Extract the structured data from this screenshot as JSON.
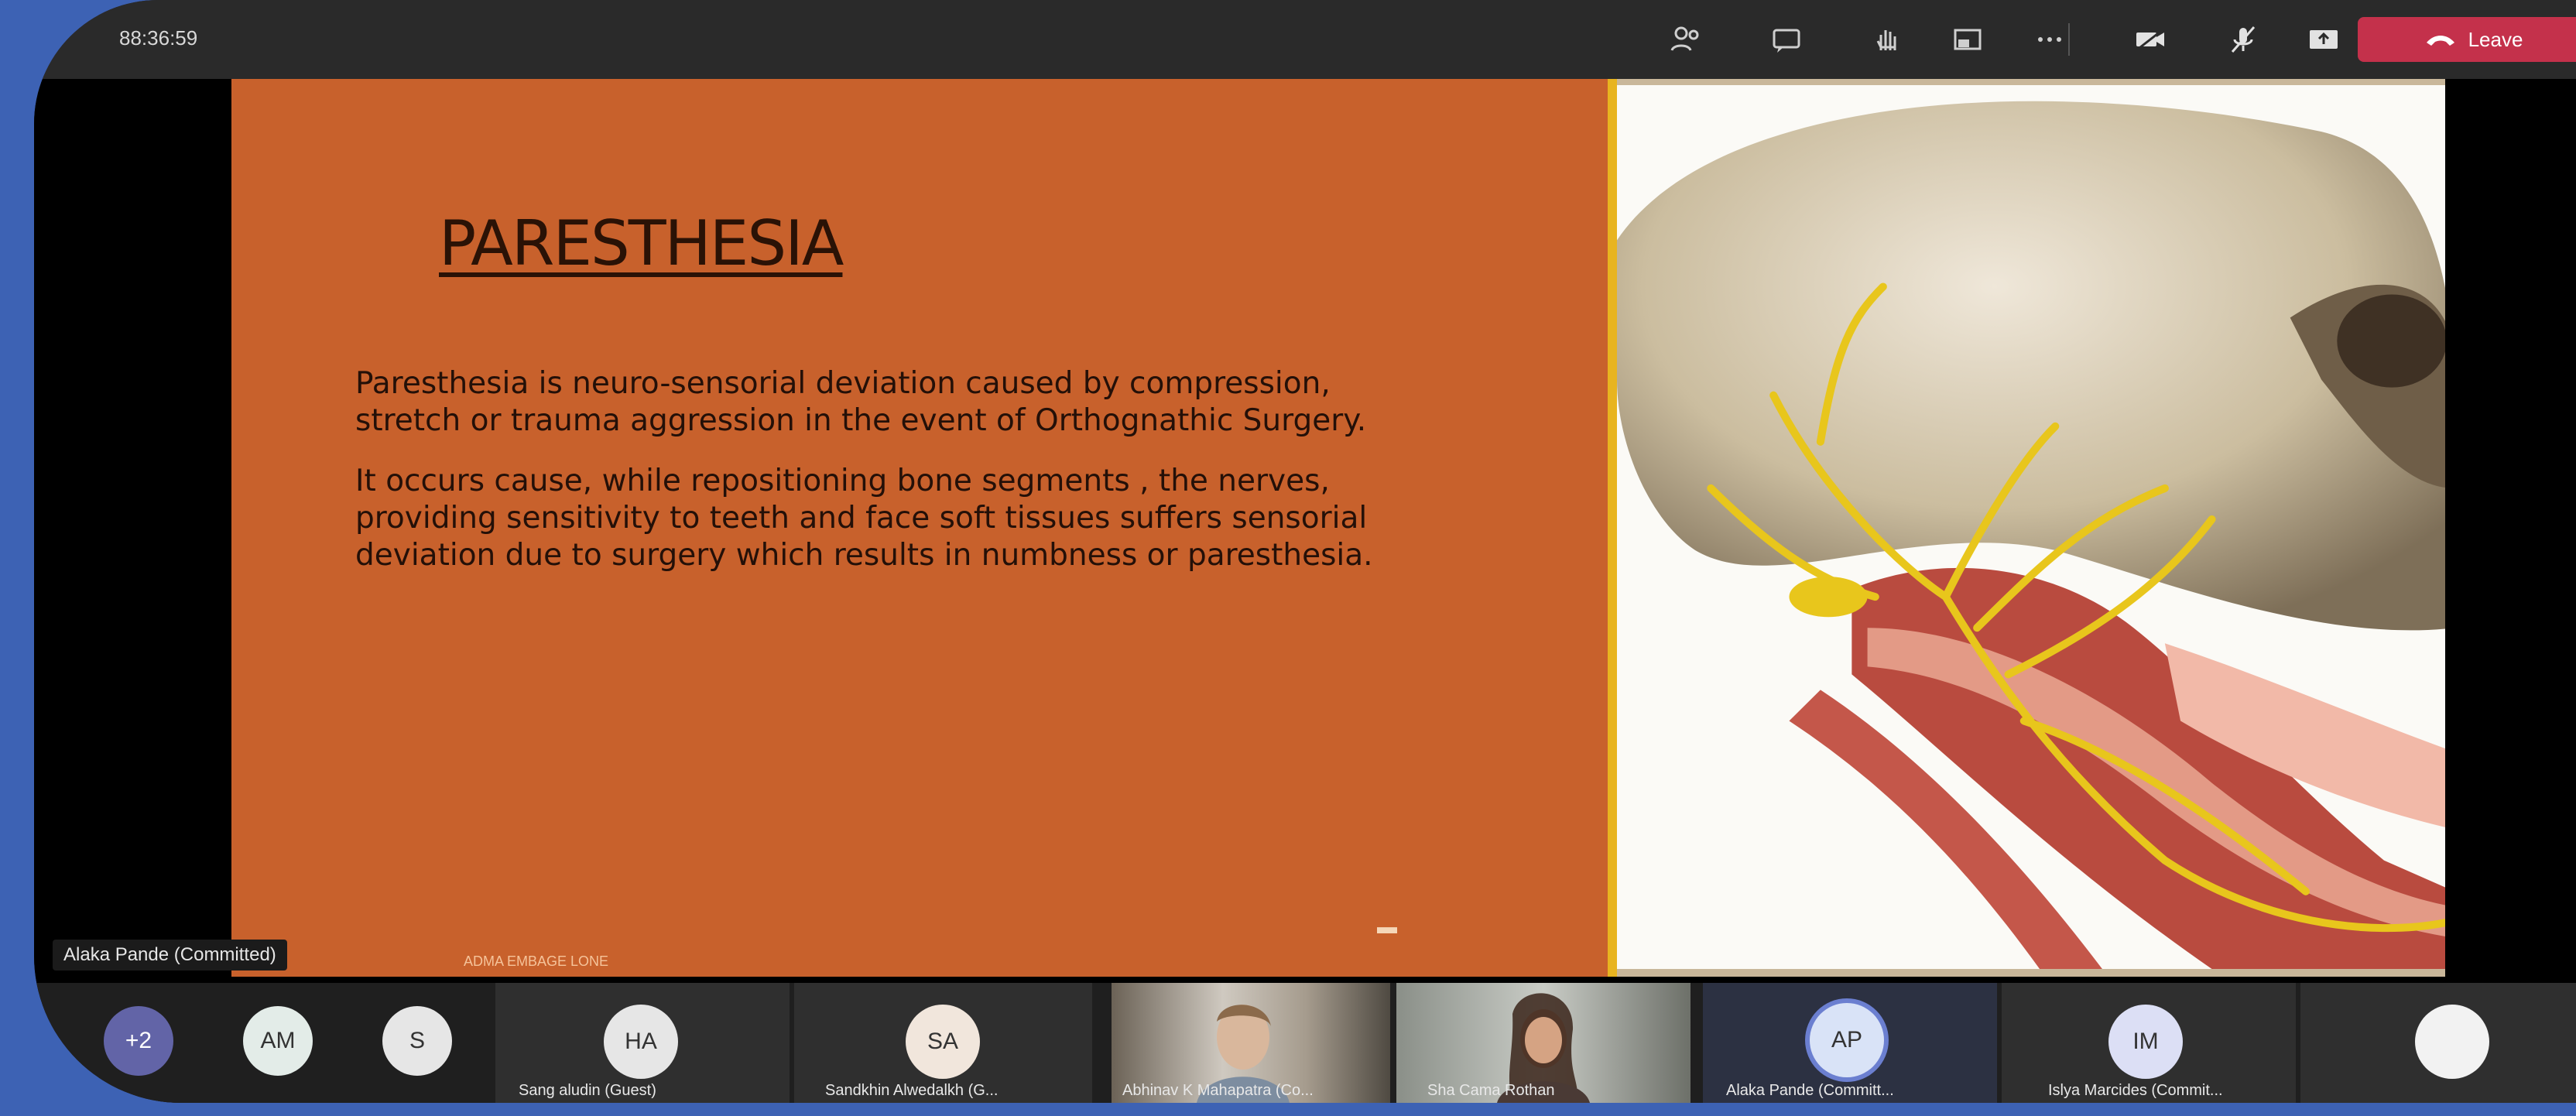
{
  "meeting": {
    "timer": "88:36:59",
    "leave_label": "Leave",
    "toolbar_icons": [
      "people-icon",
      "chat-icon",
      "raise-hand-icon",
      "breakout-rooms-icon",
      "more-options-icon",
      "camera-icon",
      "mic-icon",
      "share-tray-icon"
    ]
  },
  "slide": {
    "title": "PARESTHESIA",
    "paragraph1": "Paresthesia is neuro-sensorial deviation caused by compression, stretch or trauma aggression in the event of Orthognathic Surgery.",
    "paragraph2": "It occurs cause, while repositioning bone segments , the nerves, providing sensitivity to teeth and face soft tissues suffers sensorial deviation due to surgery which results in numbness or paresthesia.",
    "footer_text": "ADMA EMBAGE LONE",
    "image_description": "skull-nerves-illustration"
  },
  "presenter_tag": "Alaka Pande (Committed)",
  "participants": [
    {
      "initials": "+2",
      "name": ""
    },
    {
      "initials": "AM",
      "name": ""
    },
    {
      "initials": "S",
      "name": ""
    },
    {
      "initials": "HA",
      "name": "Sang aludin (Guest)"
    },
    {
      "initials": "SA",
      "name": "Sandkhin Alwedalkh (G..."
    },
    {
      "initials": "",
      "name": "Abhinav K Mahapatra (Co..."
    },
    {
      "initials": "",
      "name": "Sha Cama Rothan"
    },
    {
      "initials": "AP",
      "name": "Alaka Pande (Committ..."
    },
    {
      "initials": "IM",
      "name": "Islya Marcides (Commit..."
    },
    {
      "initials": "",
      "name": ""
    }
  ],
  "colors": {
    "slide_bg": "#c8612c",
    "leave_button": "#c4314b",
    "outer_bg": "#3d62b4",
    "accent_border": "#e8b420"
  }
}
